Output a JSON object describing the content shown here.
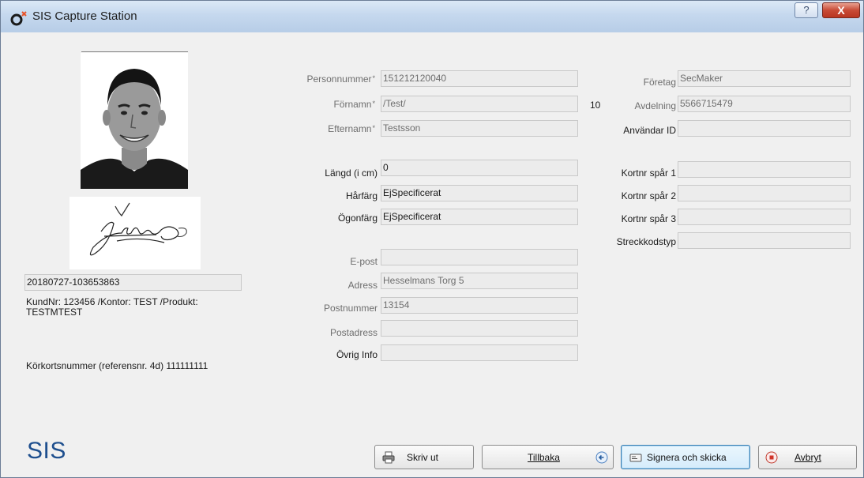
{
  "window": {
    "title": "SIS Capture Station",
    "help_glyph": "?",
    "close_glyph": "X"
  },
  "left": {
    "id_value": "20180727-103653863",
    "kund_text": "KundNr: 123456 /Kontor: TEST /Produkt: TESTMTEST",
    "korkort_text": "Körkortsnummer (referensnr. 4d) 111111111",
    "logo": "SIS"
  },
  "form": {
    "personnummer": {
      "label": "Personnummer",
      "value": "151212120040"
    },
    "fornamn": {
      "label": "Förnamn",
      "value": "/Test/"
    },
    "efternamn": {
      "label": "Efternamn",
      "value": "Testsson"
    },
    "langd": {
      "label": "Längd (i cm)",
      "value": "0"
    },
    "harfarg": {
      "label": "Hårfärg",
      "value": "EjSpecificerat"
    },
    "ogonfarg": {
      "label": "Ögonfärg",
      "value": "EjSpecificerat"
    },
    "epost": {
      "label": "E-post",
      "value": ""
    },
    "adress": {
      "label": "Adress",
      "value": "Hesselmans Torg 5"
    },
    "postnummer": {
      "label": "Postnummer",
      "value": "13154"
    },
    "postadress": {
      "label": "Postadress",
      "value": ""
    },
    "ovrig_info": {
      "label": "Övrig Info",
      "value": ""
    },
    "required_mark": "*",
    "count": "10",
    "foretag": {
      "label": "Företag",
      "value": "SecMaker"
    },
    "avdelning": {
      "label": "Avdelning",
      "value": "5566715479"
    },
    "anvandar_id": {
      "label": "Användar ID",
      "value": ""
    },
    "kortnr1": {
      "label": "Kortnr spår 1",
      "value": ""
    },
    "kortnr2": {
      "label": "Kortnr spår 2",
      "value": ""
    },
    "kortnr3": {
      "label": "Kortnr spår 3",
      "value": ""
    },
    "streckkodstyp": {
      "label": "Streckkodstyp",
      "value": ""
    }
  },
  "buttons": {
    "skriv_ut": "Skriv ut",
    "tillbaka": "Tillbaka",
    "signera": "Signera och skicka",
    "avbryt": "Avbryt"
  },
  "icons": {
    "app": "sis-logo-icon",
    "print": "printer-icon",
    "back": "back-arrow-icon",
    "sign": "card-icon",
    "cancel": "stop-icon"
  }
}
